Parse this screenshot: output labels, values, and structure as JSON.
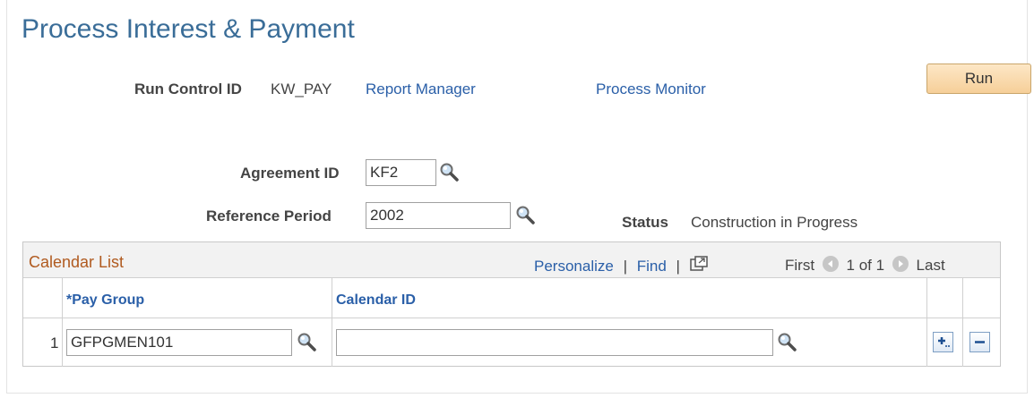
{
  "page": {
    "title": "Process Interest & Payment"
  },
  "run_control": {
    "label": "Run Control ID",
    "value": "KW_PAY",
    "report_manager": "Report Manager",
    "process_monitor": "Process Monitor",
    "run_button": "Run"
  },
  "form": {
    "agreement_label": "Agreement ID",
    "agreement_value": "KF2",
    "reference_label": "Reference Period",
    "reference_value": "2002",
    "status_label": "Status",
    "status_value": "Construction in Progress"
  },
  "grid": {
    "title": "Calendar List",
    "personalize": "Personalize",
    "separator": "|",
    "find": "Find",
    "first": "First",
    "range": "1 of 1",
    "last": "Last",
    "columns": [
      "*Pay Group",
      "Calendar ID"
    ],
    "rows": [
      {
        "num": "1",
        "pay_group": "GFPGMEN101",
        "calendar_id": ""
      }
    ]
  }
}
